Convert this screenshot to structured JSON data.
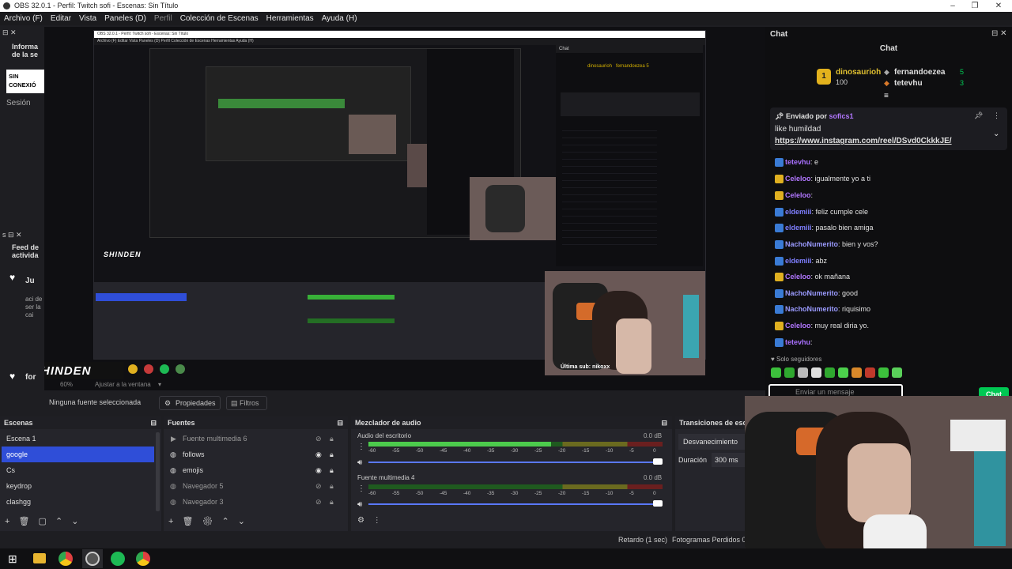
{
  "window": {
    "title": "OBS 32.0.1 - Perfil: Twitch sofi - Escenas: Sin Título"
  },
  "menu": [
    "Archivo (F)",
    "Editar",
    "Vista",
    "Paneles (D)",
    "Perfil",
    "Colección de Escenas",
    "Herramientas",
    "Ayuda (H)"
  ],
  "left_dock": {
    "info_title": "Informa de la se",
    "status": "SIN CONEXIÓ",
    "session": "Sesión",
    "feed_title": "Feed de activida",
    "feed_items": [
      "Ju",
      "aci de ser la cai",
      "for",
      "ser la cai"
    ]
  },
  "preview": {
    "zoom": "60%",
    "fit": "Ajustar a la ventana",
    "nested_title": "OBS 32.0.1 - Perfil: Twitch sofi - Escenas: Sin Título",
    "nested_menu": "Archivo (F)  Editar  Vista  Paneles (D)  Perfil  Colección de Escenas  Herramientas  Ayuda (H)",
    "brand": "SHINDEN",
    "overlay_text": "Última sub: nikoxx"
  },
  "source_toolbar": {
    "no_source": "Ninguna fuente seleccionada",
    "properties": "Propiedades",
    "filters": "Filtros"
  },
  "scenes": {
    "title": "Escenas",
    "items": [
      "Escena 1",
      "google",
      "Cs",
      "keydrop",
      "clashgg"
    ],
    "selected": "google"
  },
  "sources": {
    "title": "Fuentes",
    "items": [
      "Fuente multimedia 6",
      "follows",
      "emojis",
      "Navegador 5",
      "Navegador 3"
    ]
  },
  "mixer": {
    "title": "Mezclador de audio",
    "channels": [
      {
        "name": "Audio del escritorio",
        "db": "0.0 dB",
        "level": 0.62
      },
      {
        "name": "Fuente multimedia 4",
        "db": "0.0 dB",
        "level": 0.0
      }
    ],
    "scale": [
      "-60",
      "-55",
      "-50",
      "-45",
      "-40",
      "-35",
      "-30",
      "-25",
      "-20",
      "-15",
      "-10",
      "-5",
      "0"
    ]
  },
  "transitions": {
    "title": "Transiciones de esc",
    "type": "Desvanecimiento",
    "duration_label": "Duración",
    "duration_value": "300 ms"
  },
  "statusbar": {
    "delay": "Retardo (1 sec)",
    "dropped": "Fotogramas Perdidos 0"
  },
  "chat": {
    "dock_title": "Chat",
    "header": "Chat",
    "leaderboard": [
      {
        "rank": "1",
        "name": "dinosaurioh",
        "value": "100"
      },
      {
        "name": "fernandoezea",
        "value": "5"
      },
      {
        "name": "tetevhu",
        "value": "3"
      }
    ],
    "pinned_by_label": "Enviado por",
    "pinned_user": "sofics1",
    "pinned_text": "like humildad",
    "pinned_link": "https://www.instagram.com/reel/DSvd0CkkkJE/",
    "messages": [
      {
        "user": "tetevhu",
        "text": "e",
        "color": "#a970ff"
      },
      {
        "user": "Celeloo",
        "text": "igualmente yo a ti",
        "color": "#b277ff"
      },
      {
        "user": "Celeloo",
        "text": "",
        "color": "#b277ff"
      },
      {
        "user": "eldemiii",
        "text": "feliz cumple cele",
        "color": "#7f7fff"
      },
      {
        "user": "eldemiii",
        "text": "pasalo bien amiga",
        "color": "#7f7fff"
      },
      {
        "user": "NachoNumerito",
        "text": "bien y vos?",
        "color": "#9b9bff"
      },
      {
        "user": "eldemiii",
        "text": "abz",
        "color": "#7f7fff"
      },
      {
        "user": "Celeloo",
        "text": "ok mañana",
        "color": "#b277ff"
      },
      {
        "user": "NachoNumerito",
        "text": "good",
        "color": "#9b9bff"
      },
      {
        "user": "NachoNumerito",
        "text": "riquisimo",
        "color": "#9b9bff"
      },
      {
        "user": "Celeloo",
        "text": "muy real diria yo.",
        "color": "#b277ff"
      },
      {
        "user": "tetevhu",
        "text": "",
        "color": "#a970ff"
      }
    ],
    "followers_only": "Solo seguidores",
    "input_placeholder": "Enviar un mensaje",
    "send": "Chat"
  },
  "colors": {
    "accent": "#2f4ed8",
    "twitch": "#9146ff",
    "green": "#00c853"
  }
}
